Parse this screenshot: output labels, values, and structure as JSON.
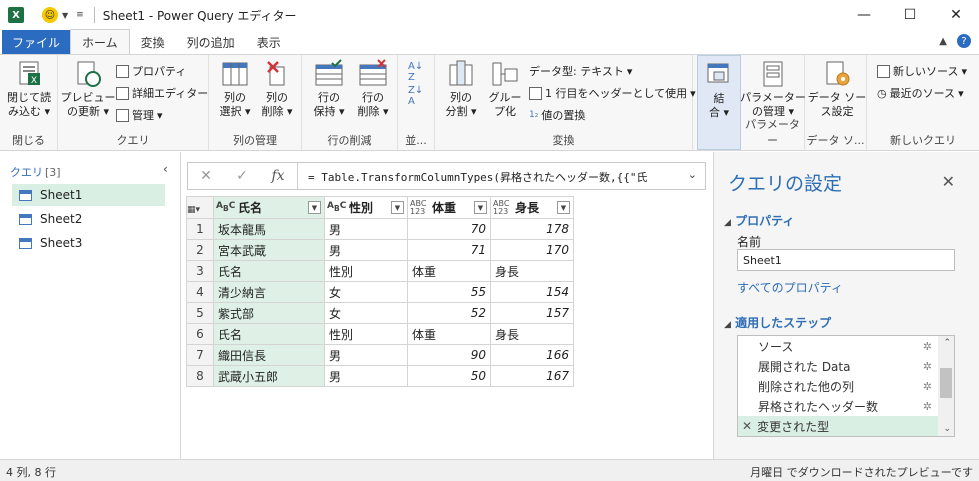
{
  "window": {
    "title": "Sheet1 - Power Query エディター"
  },
  "tabs": [
    {
      "label": "ファイル"
    },
    {
      "label": "ホーム"
    },
    {
      "label": "変換"
    },
    {
      "label": "列の追加"
    },
    {
      "label": "表示"
    }
  ],
  "ribbon": {
    "close": {
      "btn": "閉じて読\nみ込む",
      "group": "閉じる"
    },
    "query": {
      "preview": "プレビュー\nの更新",
      "properties": "プロパティ",
      "advanced": "詳細エディター",
      "manage": "管理",
      "group": "クエリ"
    },
    "columns": {
      "choose": "列の\n選択",
      "remove": "列の\n削除",
      "group": "列の管理"
    },
    "rows": {
      "keep": "行の\n保持",
      "remove": "行の\n削除",
      "group": "行の削減"
    },
    "sort": {
      "group": "並..."
    },
    "transform": {
      "split": "列の\n分割",
      "groupby": "グルー\nプ化",
      "datatype": "データ型: テキスト",
      "firstrow": "1 行目をヘッダーとして使用",
      "replace": "値の置換",
      "group": "変換"
    },
    "combine": {
      "btn": "結\n合"
    },
    "params": {
      "btn": "パラメーター\nの管理",
      "group": "パラメーター"
    },
    "datasource": {
      "btn": "データ ソー\nス設定",
      "group": "データ ソ..."
    },
    "newquery": {
      "newsource": "新しいソース",
      "recent": "最近のソース",
      "group": "新しいクエリ"
    }
  },
  "queries": {
    "header": "クエリ",
    "count": "[3]",
    "items": [
      "Sheet1",
      "Sheet2",
      "Sheet3"
    ]
  },
  "formula": {
    "text": "= Table.TransformColumnTypes(昇格されたヘッダー数,{{\"氏"
  },
  "table": {
    "columns": [
      {
        "name": "氏名",
        "type": "ABC"
      },
      {
        "name": "性別",
        "type": "ABC"
      },
      {
        "name": "体重",
        "type": "ABC123"
      },
      {
        "name": "身長",
        "type": "ABC123"
      }
    ],
    "rows": [
      [
        "1",
        "坂本龍馬",
        "男",
        "70",
        "178"
      ],
      [
        "2",
        "宮本武蔵",
        "男",
        "71",
        "170"
      ],
      [
        "3",
        "氏名",
        "性別",
        "体重",
        "身長"
      ],
      [
        "4",
        "清少納言",
        "女",
        "55",
        "154"
      ],
      [
        "5",
        "紫式部",
        "女",
        "52",
        "157"
      ],
      [
        "6",
        "氏名",
        "性別",
        "体重",
        "身長"
      ],
      [
        "7",
        "織田信長",
        "男",
        "90",
        "166"
      ],
      [
        "8",
        "武蔵小五郎",
        "男",
        "50",
        "167"
      ]
    ]
  },
  "settings": {
    "title": "クエリの設定",
    "properties_header": "プロパティ",
    "name_label": "名前",
    "name_value": "Sheet1",
    "all_properties": "すべてのプロパティ",
    "steps_header": "適用したステップ",
    "steps": [
      "ソース",
      "展開された Data",
      "削除された他の列",
      "昇格されたヘッダー数",
      "変更された型"
    ]
  },
  "status": {
    "left": "4 列, 8 行",
    "right": "月曜日 でダウンロードされたプレビューです"
  }
}
